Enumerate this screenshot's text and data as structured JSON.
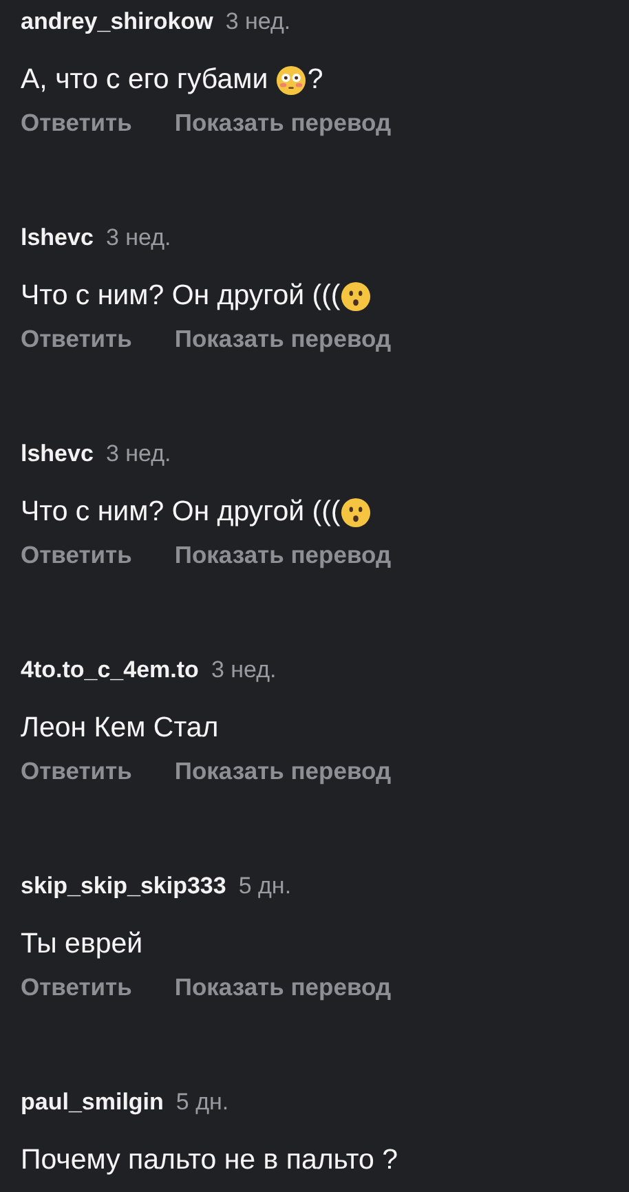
{
  "comments": [
    {
      "username": "andrey_shirokow",
      "time": "3 нед.",
      "body": [
        {
          "kind": "text",
          "text": "А, что с его губами "
        },
        {
          "kind": "flushed"
        },
        {
          "kind": "text",
          "text": "?"
        }
      ],
      "actions": [
        "Ответить",
        "Показать перевод"
      ]
    },
    {
      "username": "lshevc",
      "time": "3 нед.",
      "body": [
        {
          "kind": "text",
          "text": "Что с ним? Он другой ((("
        },
        {
          "kind": "hushed"
        }
      ],
      "actions": [
        "Ответить",
        "Показать перевод"
      ]
    },
    {
      "username": "lshevc",
      "time": "3 нед.",
      "body": [
        {
          "kind": "text",
          "text": "Что с ним? Он другой ((("
        },
        {
          "kind": "hushed"
        }
      ],
      "actions": [
        "Ответить",
        "Показать перевод"
      ]
    },
    {
      "username": "4to.to_c_4em.to",
      "time": "3 нед.",
      "body": [
        {
          "kind": "text",
          "text": "Леон Кем Стал"
        }
      ],
      "actions": [
        "Ответить",
        "Показать перевод"
      ]
    },
    {
      "username": "skip_skip_skip333",
      "time": "5 дн.",
      "body": [
        {
          "kind": "text",
          "text": "Ты еврей"
        }
      ],
      "actions": [
        "Ответить",
        "Показать перевод"
      ]
    },
    {
      "username": "paul_smilgin",
      "time": "5 дн.",
      "body": [
        {
          "kind": "text",
          "text": "Почему пальто не в пальто ?"
        }
      ]
    }
  ]
}
